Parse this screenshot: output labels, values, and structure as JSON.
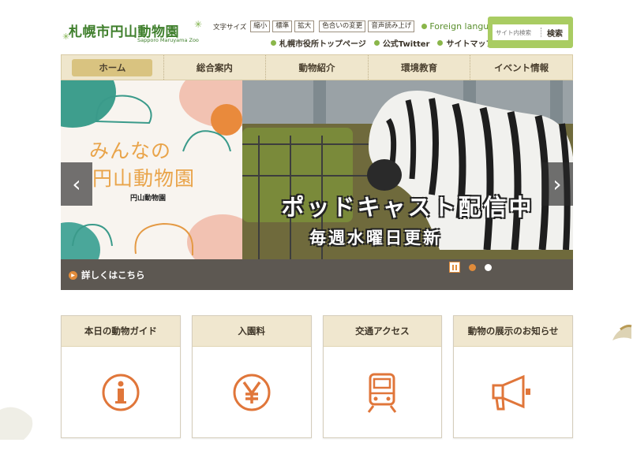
{
  "header": {
    "logo_title": "札幌市円山動物園",
    "logo_subtitle": "Sapporo Maruyama Zoo",
    "font_size_label": "文字サイズ",
    "font_size_buttons": [
      "縮小",
      "標準",
      "拡大"
    ],
    "color_change": "色合いの変更",
    "read_aloud": "音声読み上げ",
    "foreign_language": "Foreign language",
    "links": [
      "札幌市役所トップページ",
      "公式Twitter",
      "サイトマップ"
    ],
    "search": {
      "placeholder": "サイト内検索",
      "button": "検索"
    }
  },
  "nav": {
    "items": [
      "ホーム",
      "総合案内",
      "動物紹介",
      "環境教育",
      "イベント情報"
    ],
    "active_index": 0
  },
  "hero": {
    "panel_title_line1": "みんなの",
    "panel_title_line2": "円山動物園",
    "panel_logo": "円山動物園",
    "overlay_line1": "ポッドキャスト配信中",
    "overlay_line2": "毎週水曜日更新",
    "caption": "詳しくはこちら",
    "prev_icon": "‹",
    "next_icon": "›",
    "slide_count": 2,
    "active_slide": 1
  },
  "cards": [
    {
      "title": "本日の動物ガイド",
      "icon": "info-icon"
    },
    {
      "title": "入園料",
      "icon": "yen-icon"
    },
    {
      "title": "交通アクセス",
      "icon": "train-icon"
    },
    {
      "title": "動物の展示のお知らせ",
      "icon": "megaphone-icon"
    }
  ],
  "colors": {
    "accent_green": "#a9cc62",
    "logo_green": "#3f7f2c",
    "nav_bg": "#efe6cc",
    "icon_orange": "#e0763a",
    "indicator_orange": "#e08b3a"
  }
}
